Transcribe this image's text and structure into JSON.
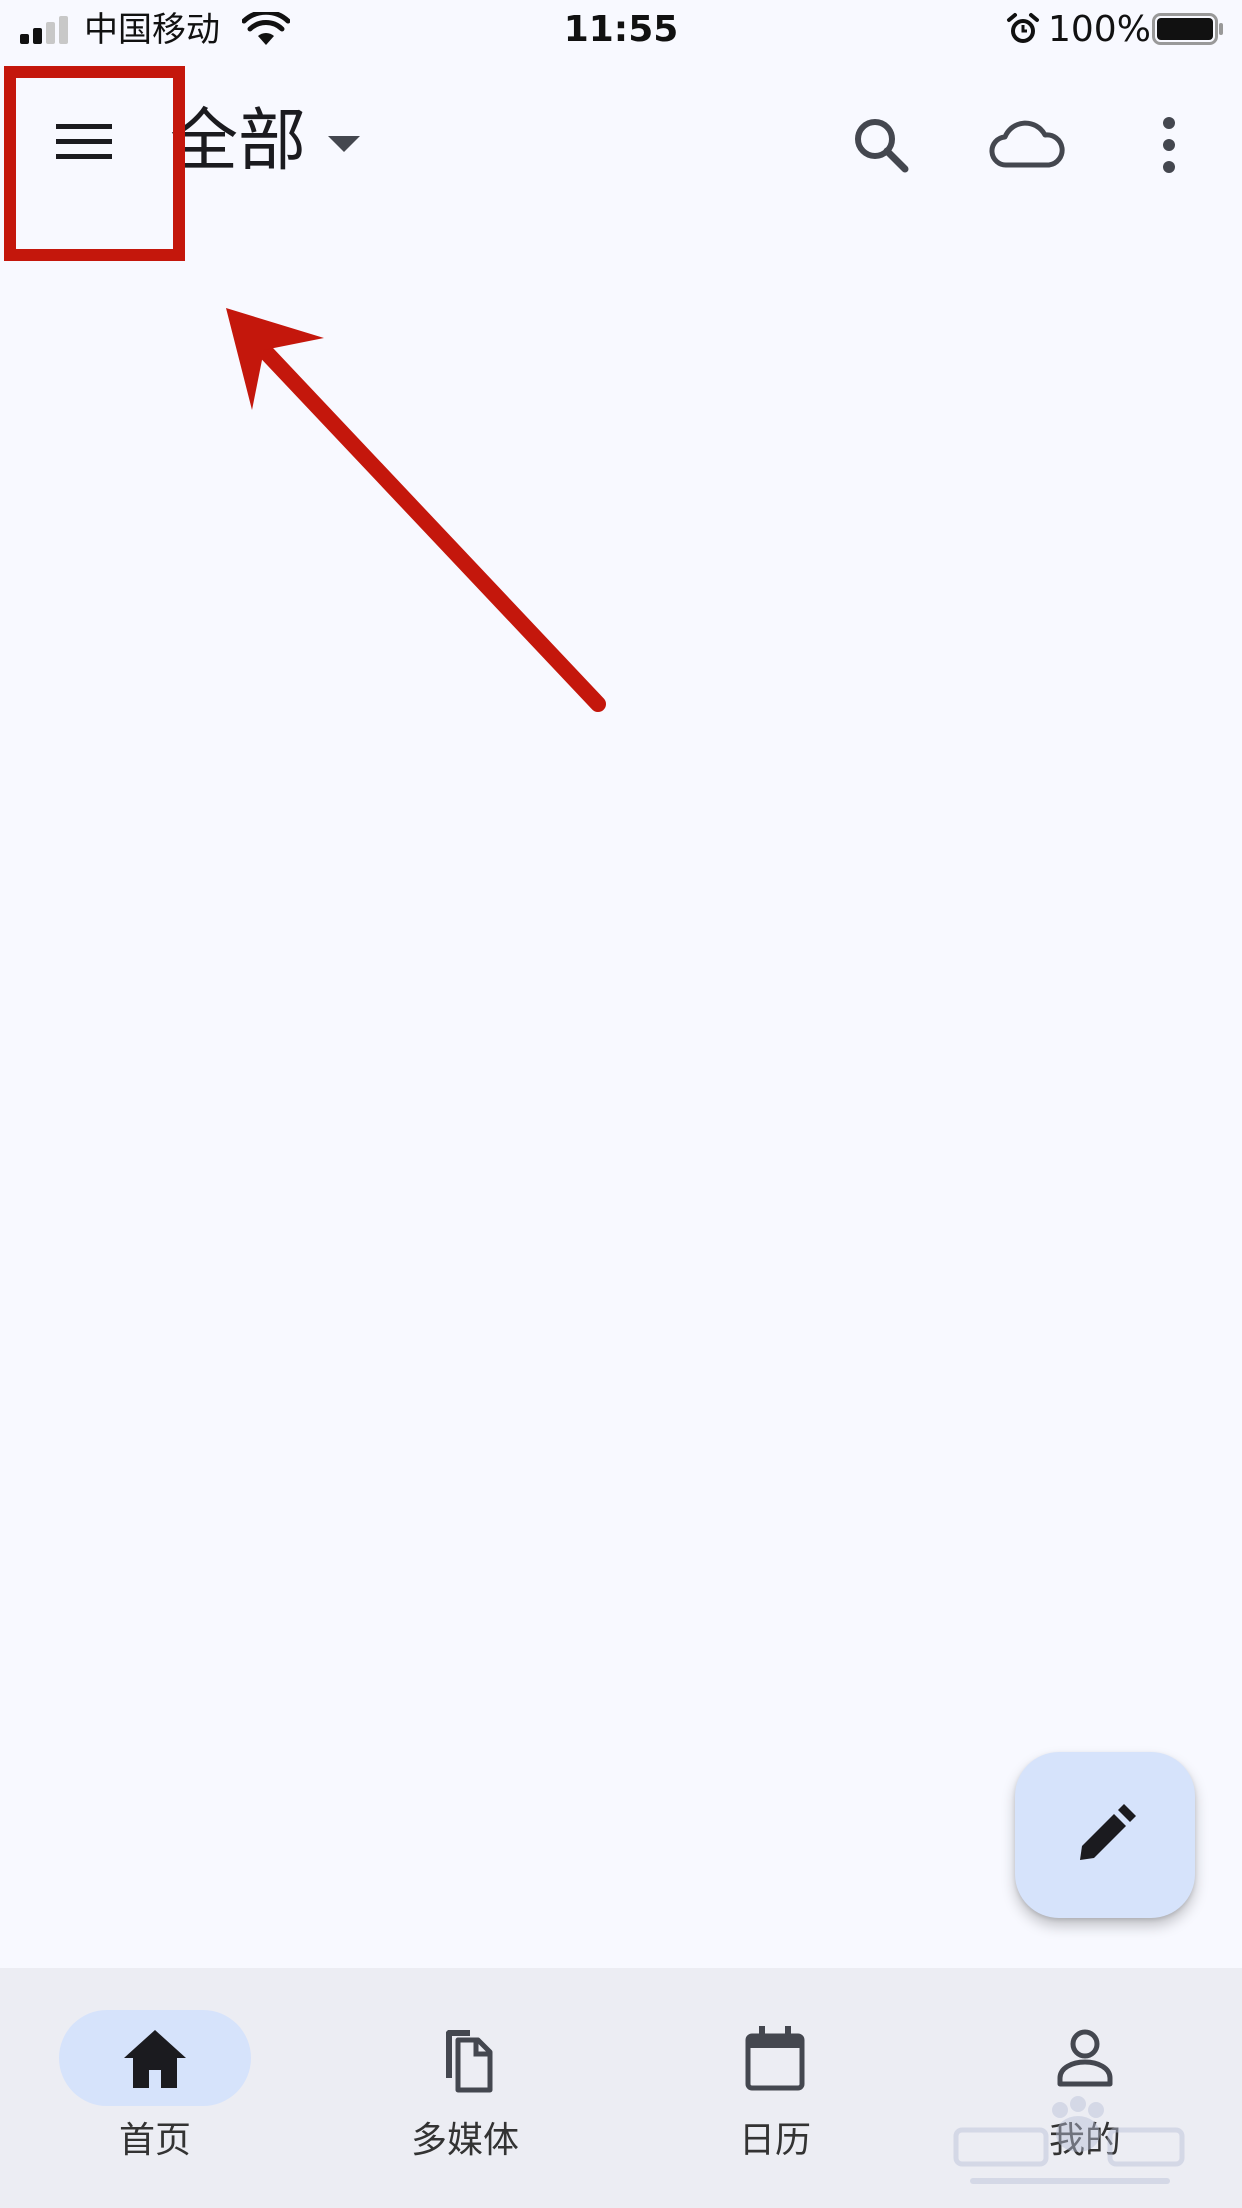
{
  "status_bar": {
    "carrier": "中国移动",
    "time": "11:55",
    "battery_percent": "100%",
    "signal_bars": 2,
    "icons": [
      "signal-icon",
      "wifi-icon",
      "alarm-icon",
      "battery-icon"
    ]
  },
  "top_app_bar": {
    "menu_icon": "menu-icon",
    "title": "全部",
    "title_has_dropdown": true,
    "actions": [
      "search-icon",
      "cloud-icon",
      "more-vert-icon"
    ]
  },
  "fab": {
    "icon": "edit-pencil-icon"
  },
  "bottom_nav": {
    "selected_index": 0,
    "items": [
      {
        "label": "首页",
        "icon": "home-icon"
      },
      {
        "label": "多媒体",
        "icon": "media-copy-icon"
      },
      {
        "label": "日历",
        "icon": "calendar-icon"
      },
      {
        "label": "我的",
        "icon": "person-icon"
      }
    ]
  },
  "annotation": {
    "highlight": "menu-button",
    "color": "#c4170c"
  },
  "colors": {
    "background": "#f8f9ff",
    "nav_background": "#ecedf3",
    "accent_container": "#d6e3fb",
    "annotation_red": "#c4170c"
  }
}
